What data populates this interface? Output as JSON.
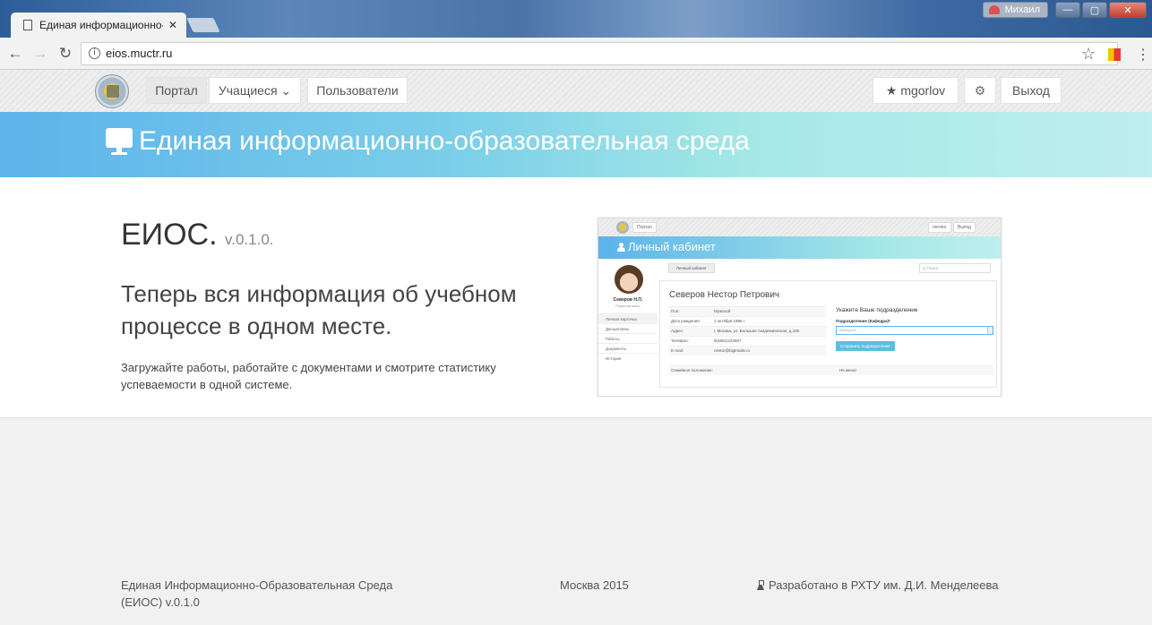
{
  "browser": {
    "tab_title": "Единая информационно-образовательная среда",
    "tab_close": "✕",
    "user_badge": "Михаил",
    "url": "eios.muctr.ru",
    "win_min": "—",
    "win_max": "▢",
    "win_close": "✕"
  },
  "nav": {
    "portal": "Портал",
    "students": "Учащиеся ⌄",
    "users": "Пользователи",
    "user": "★ mgorlov",
    "logout": "Выход"
  },
  "hero": {
    "title": "Единая информационно-образовательная среда"
  },
  "main": {
    "brand_name": "ЕИОС.",
    "brand_version": "v.0.1.0.",
    "tagline": "Теперь вся информация об учебном процессе в одном месте.",
    "description": "Загружайте работы, работайте с документами и смотрите статистику успеваемости в одной системе."
  },
  "preview": {
    "nav_portal": "Портал",
    "nav_user": "mentor",
    "nav_logout": "Выход",
    "hero_title": "Личный кабинет",
    "side_name": "Северов Н.П.",
    "side_sub": "Редактировать",
    "menu": [
      "Личная карточка",
      "Дисциплины",
      "Работы",
      "Документы",
      "История"
    ],
    "crumb": "Личный кабинет",
    "search_placeholder": "Q Поиск",
    "person_name": "Северов Нестор Петрович",
    "rows": [
      {
        "k": "Пол:",
        "v": "Мужской"
      },
      {
        "k": "Дата рождения:",
        "v": "1 октября 1986 г."
      },
      {
        "k": "Адрес:",
        "v": "г. Москва, ул. Большая Академическая, д.105"
      },
      {
        "k": "Телефон:",
        "v": "8(499)1234567"
      },
      {
        "k": "E-mail:",
        "v": "nestor@bigtmails.ru"
      }
    ],
    "dept_title": "Укажите Ваше подразделение",
    "dept_label": "Подразделение (Кафедра)*",
    "dept_placeholder": "Выберите...",
    "save_button": "Сохранить подразделение",
    "family_k": "Семейное положение:",
    "family_v": "Не женат"
  },
  "footer": {
    "left": "Единая Информационно-Образовательная Среда (ЕИОС) v.0.1.0",
    "center": "Москва 2015",
    "right": "Разработано в РХТУ им. Д.И. Менделеева"
  },
  "colors": {
    "hero_start": "#5cb3ea",
    "hero_end": "#bfeff0",
    "nav_bg": "#eeeeee",
    "footer_bg": "#f1f1f1"
  }
}
